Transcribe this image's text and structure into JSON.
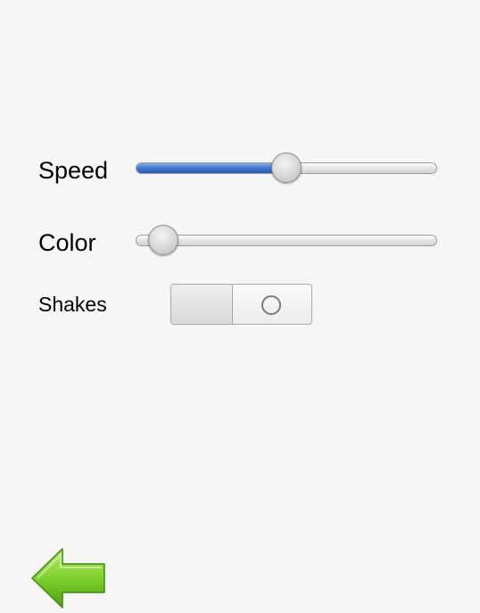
{
  "settings": {
    "speed": {
      "label": "Speed",
      "value": 0.5,
      "fill_color": "#3f76d2"
    },
    "color": {
      "label": "Color",
      "value": 0.05
    },
    "shakes": {
      "label": "Shakes",
      "state": "off"
    }
  },
  "navigation": {
    "back_icon": "green-left-arrow-icon",
    "arrow_color": "#6cc021"
  }
}
